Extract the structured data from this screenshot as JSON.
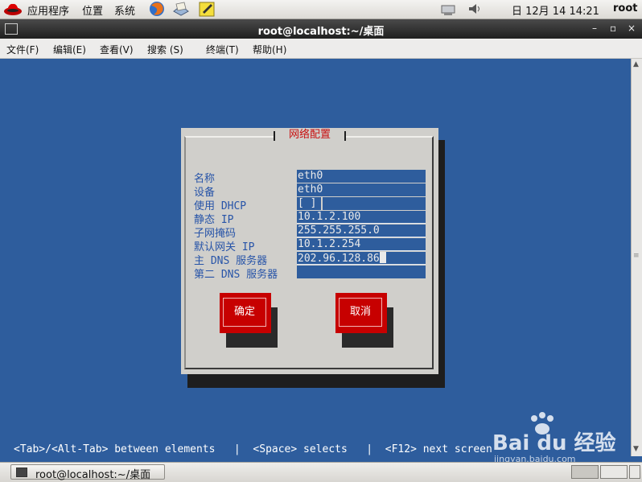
{
  "top_panel": {
    "applications": "应用程序",
    "places": "位置",
    "system": "系统",
    "clock": "日 12月 14 14:21",
    "user": "root"
  },
  "window": {
    "title": "root@localhost:~/桌面",
    "min": "–",
    "max": "▫",
    "close": "×"
  },
  "menubar": {
    "file": "文件(F)",
    "edit": "编辑(E)",
    "view": "查看(V)",
    "search": "搜索 (S)",
    "terminal": "终端(T)",
    "help": "帮助(H)"
  },
  "dialog": {
    "title": "网络配置",
    "fields": [
      {
        "label": "名称",
        "value": "eth0"
      },
      {
        "label": "设备",
        "value": "eth0"
      },
      {
        "label": "使用 DHCP",
        "value": "[ ]"
      },
      {
        "label": "静态 IP",
        "value": "10.1.2.100"
      },
      {
        "label": "子网掩码",
        "value": "255.255.255.0"
      },
      {
        "label": "默认网关 IP",
        "value": "10.1.2.254"
      },
      {
        "label": "主 DNS 服务器",
        "value": "202.96.128.86"
      },
      {
        "label": "第二 DNS 服务器",
        "value": ""
      }
    ],
    "ok": "确定",
    "cancel": "取消"
  },
  "help_line": "<Tab>/<Alt-Tab> between elements   |  <Space> selects   |  <F12> next screen",
  "watermark": {
    "brand": "Bai du 经验",
    "url": "jingyan.baidu.com"
  },
  "taskbar": {
    "task_label": "root@localhost:~/桌面"
  },
  "colors": {
    "terminal_bg": "#2e5d9d",
    "dialog_bg": "#d0cfcb",
    "button_red": "#c70000",
    "label_blue": "#2754a8"
  }
}
